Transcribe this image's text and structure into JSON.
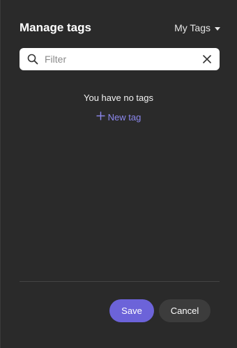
{
  "dialog": {
    "title": "Manage tags",
    "scope_label": "My Tags"
  },
  "filter": {
    "placeholder": "Filter",
    "value": ""
  },
  "empty_state": {
    "message": "You have no tags",
    "new_tag_label": "New tag"
  },
  "footer": {
    "save_label": "Save",
    "cancel_label": "Cancel"
  },
  "colors": {
    "background": "#2a2a2a",
    "accent": "#6c63d9",
    "link": "#8c88ee",
    "secondary_button": "#3c3c3c"
  },
  "icons": {
    "search": "search-icon",
    "clear": "close-icon",
    "dropdown": "chevron-down-icon",
    "add": "plus-icon"
  }
}
